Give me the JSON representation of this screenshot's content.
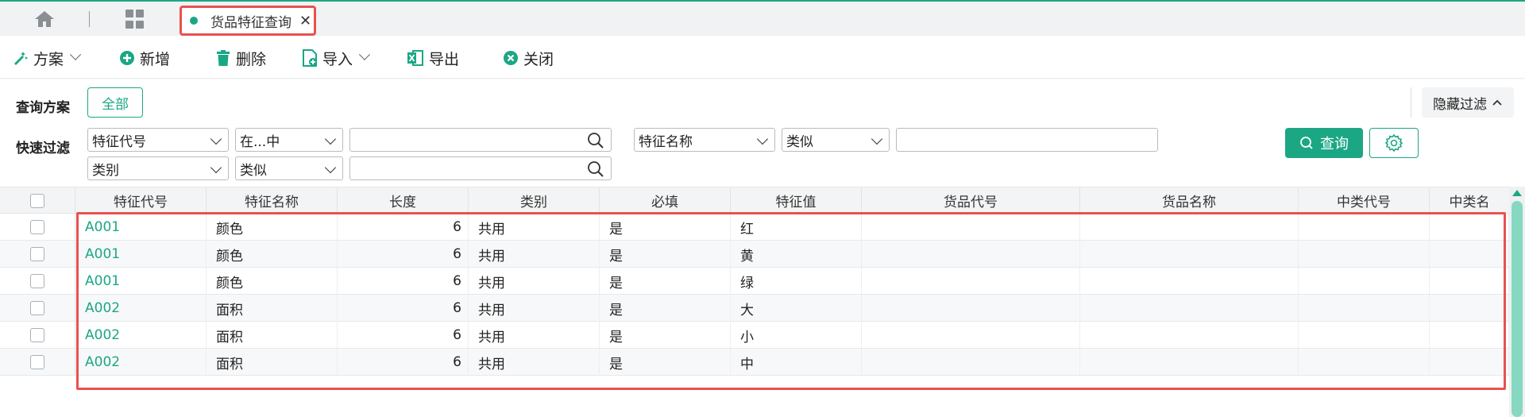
{
  "colors": {
    "accent": "#1ba784",
    "highlight": "#e8524f"
  },
  "tabs": {
    "active_label": "货品特征查询",
    "close_glyph": "✕"
  },
  "toolbar": {
    "scheme": "方案",
    "add": "新增",
    "delete": "删除",
    "import": "导入",
    "export": "导出",
    "close": "关闭"
  },
  "filter": {
    "scheme_label": "查询方案",
    "all_button": "全部",
    "hide_filter": "隐藏过滤",
    "quick_label": "快速过滤",
    "row1": {
      "field1": "特征代号",
      "op1": "在...中",
      "value1": "",
      "value1_placeholder": "",
      "field2": "特征名称",
      "op2": "类似",
      "value2": "",
      "value2_placeholder": ""
    },
    "row2": {
      "field": "类别",
      "op": "类似",
      "value": "",
      "value_placeholder": ""
    },
    "query_button": "查询"
  },
  "table": {
    "columns": [
      "特征代号",
      "特征名称",
      "长度",
      "类别",
      "必填",
      "特征值",
      "货品代号",
      "货品名称",
      "中类代号",
      "中类名"
    ],
    "rows": [
      {
        "code": "A001",
        "name": "颜色",
        "length": "6",
        "category": "共用",
        "required": "是",
        "value": "红"
      },
      {
        "code": "A001",
        "name": "颜色",
        "length": "6",
        "category": "共用",
        "required": "是",
        "value": "黄"
      },
      {
        "code": "A001",
        "name": "颜色",
        "length": "6",
        "category": "共用",
        "required": "是",
        "value": "绿"
      },
      {
        "code": "A002",
        "name": "面积",
        "length": "6",
        "category": "共用",
        "required": "是",
        "value": "大"
      },
      {
        "code": "A002",
        "name": "面积",
        "length": "6",
        "category": "共用",
        "required": "是",
        "value": "小"
      },
      {
        "code": "A002",
        "name": "面积",
        "length": "6",
        "category": "共用",
        "required": "是",
        "value": "中"
      }
    ]
  }
}
